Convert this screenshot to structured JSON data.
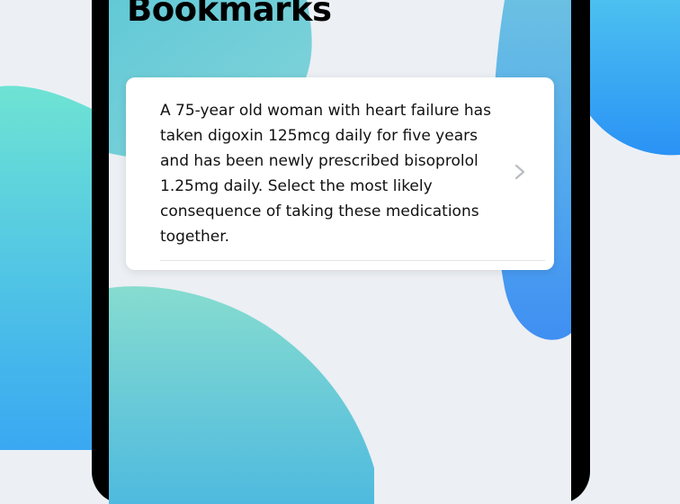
{
  "screen": {
    "title": "Bookmarks"
  },
  "bookmarks": [
    {
      "question": "A 75-year old woman with heart failure has taken digoxin 125mcg daily for five years and has been newly prescribed bisoprolol 1.25mg daily. Select the most likely consequence of taking these medications together.",
      "icon": "chevron-right-icon"
    }
  ],
  "colors": {
    "background": "#ecf0f5",
    "teal_blob": "#6edcd2",
    "blue_blob": "#3a8ff2",
    "frame": "#000000",
    "card": "#ffffff"
  }
}
